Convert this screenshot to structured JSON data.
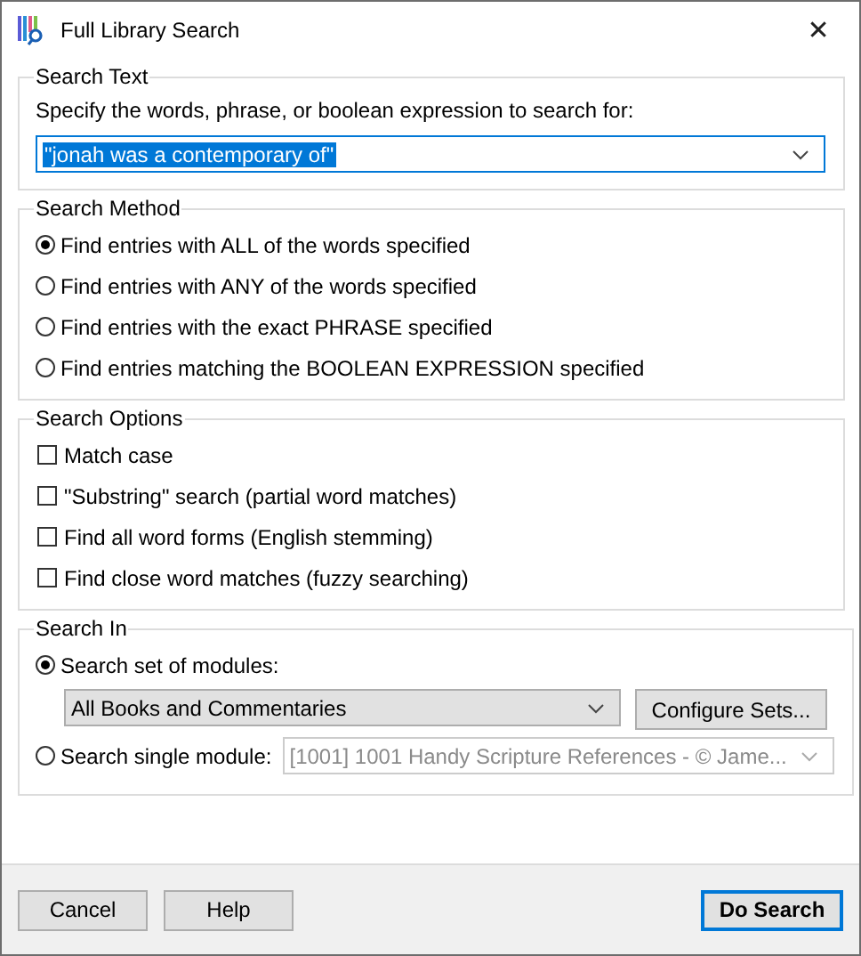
{
  "window": {
    "title": "Full Library Search",
    "close": "✕"
  },
  "search_text": {
    "legend": "Search Text",
    "prompt": "Specify the words, phrase, or boolean expression to search for:",
    "value": "\"jonah was a contemporary of\"",
    "text_selected": true
  },
  "search_method": {
    "legend": "Search Method",
    "options": [
      {
        "label": "Find entries with ALL of the words specified",
        "selected": true
      },
      {
        "label": "Find entries with ANY of the words specified",
        "selected": false
      },
      {
        "label": "Find entries with the exact PHRASE specified",
        "selected": false
      },
      {
        "label": "Find entries matching the BOOLEAN EXPRESSION specified",
        "selected": false
      }
    ]
  },
  "search_options": {
    "legend": "Search Options",
    "options": [
      {
        "label": "Match case",
        "checked": false
      },
      {
        "label": "\"Substring\" search (partial word matches)",
        "checked": false
      },
      {
        "label": "Find all word forms (English stemming)",
        "checked": false
      },
      {
        "label": "Find close word matches (fuzzy searching)",
        "checked": false
      }
    ]
  },
  "search_in": {
    "legend": "Search In",
    "set": {
      "label": "Search set of modules:",
      "selected": true,
      "value": "All Books and Commentaries",
      "button": "Configure Sets..."
    },
    "single": {
      "label": "Search single module:",
      "selected": false,
      "value": "[1001] 1001 Handy Scripture References - © Jame...",
      "disabled": true
    }
  },
  "buttons": [
    {
      "label": "Cancel",
      "default": false
    },
    {
      "label": "Help",
      "default": false
    },
    {
      "label": "Do Search",
      "default": true
    }
  ]
}
